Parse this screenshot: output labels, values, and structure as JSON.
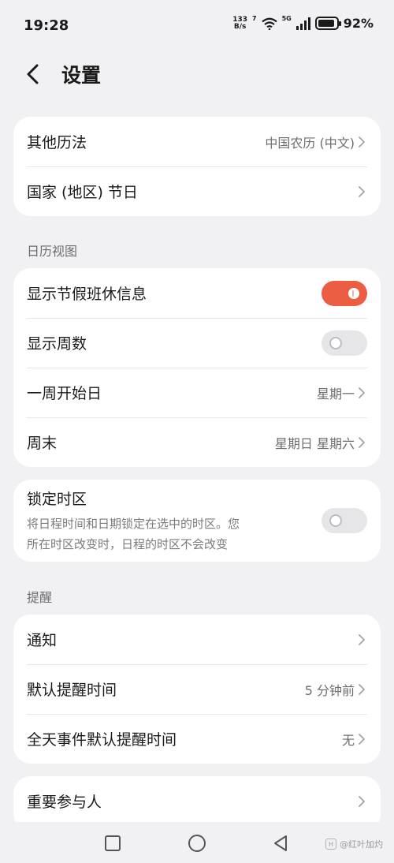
{
  "status_bar": {
    "time": "19:28",
    "speed_value": "133",
    "speed_unit": "B/s",
    "wifi_label": "7",
    "signal_label": "5G",
    "battery_text": "92%"
  },
  "header": {
    "title": "设置"
  },
  "card1": {
    "rows": [
      {
        "label": "其他历法",
        "value": "中国农历 (中文)"
      },
      {
        "label": "国家 (地区) 节日",
        "value": ""
      }
    ]
  },
  "calendar_view": {
    "section_title": "日历视图",
    "show_holiday": {
      "label": "显示节假班休信息",
      "enabled": true
    },
    "show_week_no": {
      "label": "显示周数",
      "enabled": false
    },
    "week_start": {
      "label": "一周开始日",
      "value": "星期一"
    },
    "weekend": {
      "label": "周末",
      "value": "星期日 星期六"
    }
  },
  "timezone": {
    "title": "锁定时区",
    "desc_line1": "将日程时间和日期锁定在选中的时区。您",
    "desc_line2": "所在时区改变时，日程的时区不会改变",
    "enabled": false
  },
  "reminder": {
    "section_title": "提醒",
    "notification": {
      "label": "通知"
    },
    "default_time": {
      "label": "默认提醒时间",
      "value": "5 分钟前"
    },
    "allday_time": {
      "label": "全天事件默认提醒时间",
      "value": "无"
    }
  },
  "card_last": {
    "label": "重要参与人"
  },
  "watermark": {
    "text": "@红叶加灼",
    "badge": "H"
  },
  "colors": {
    "accent": "#ec5e43",
    "background": "#f1f1f3",
    "card": "#ffffff",
    "secondary_text": "#6d6d72"
  }
}
